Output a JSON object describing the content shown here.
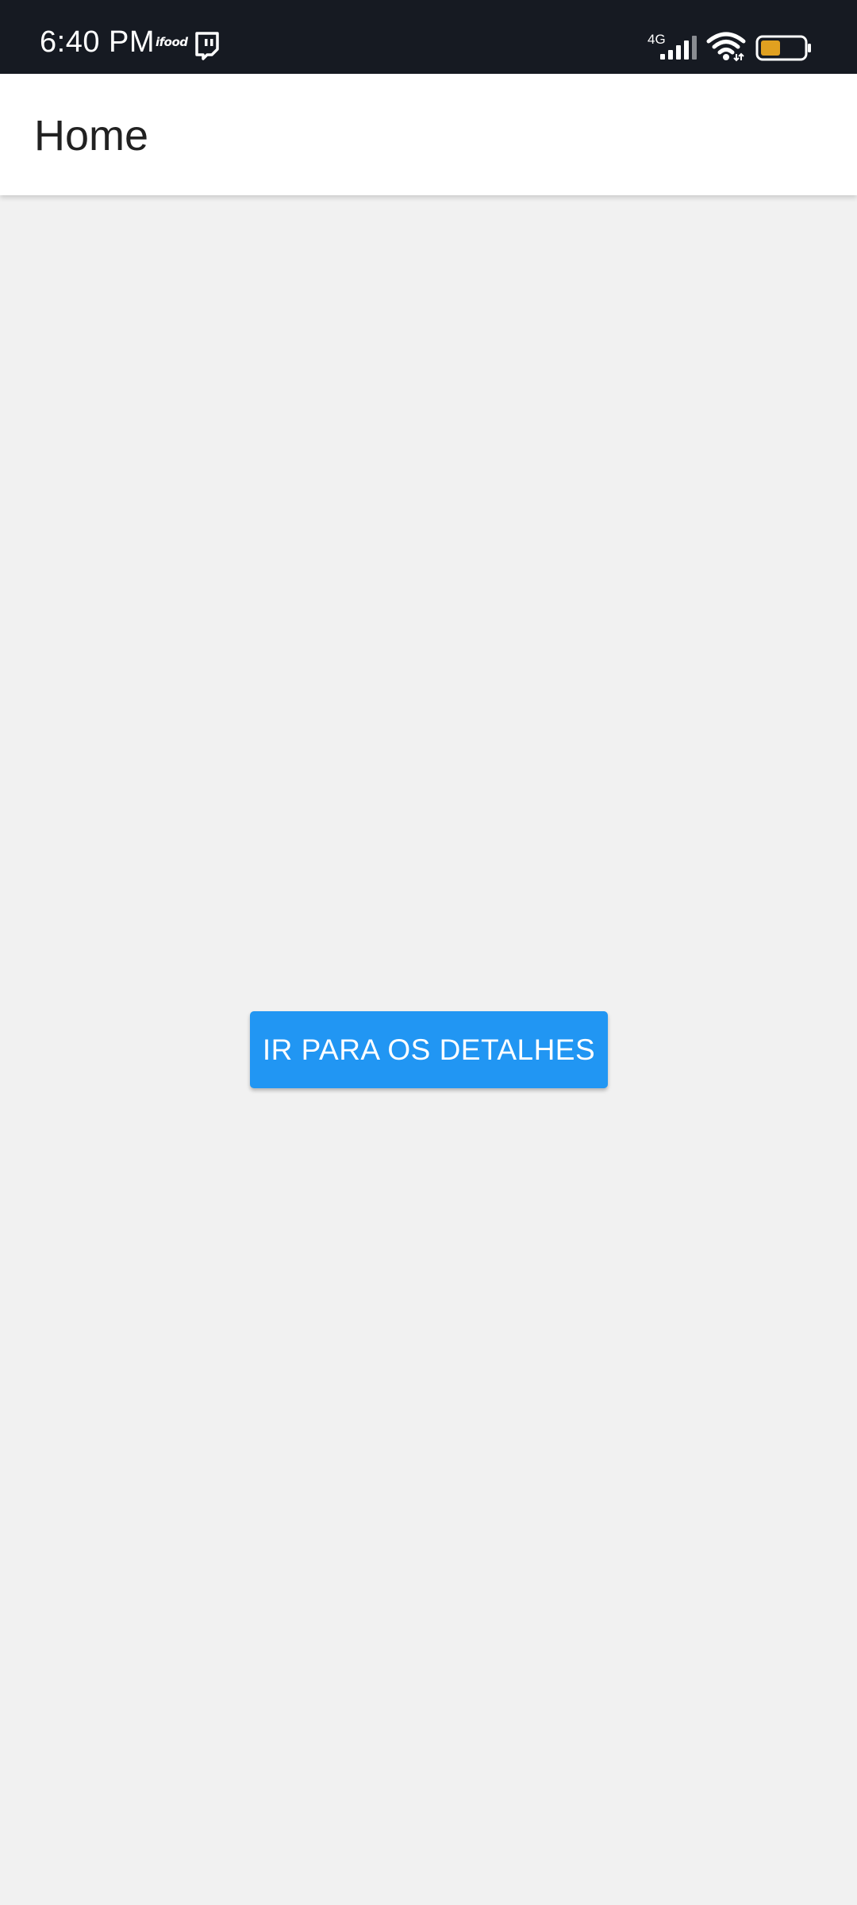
{
  "status_bar": {
    "time": "6:40 PM",
    "notification_icons": [
      "ifood-icon",
      "twitch-icon"
    ],
    "ifood_text": "ifood",
    "network_label": "4G",
    "battery_color": "#e0a020",
    "battery_level": 0.45
  },
  "app_bar": {
    "title": "Home"
  },
  "main": {
    "button_label": "IR PARA OS DETALHES"
  },
  "colors": {
    "status_bar_bg": "#161a22",
    "app_bar_bg": "#ffffff",
    "background": "#f1f1f1",
    "accent": "#2196f3"
  }
}
